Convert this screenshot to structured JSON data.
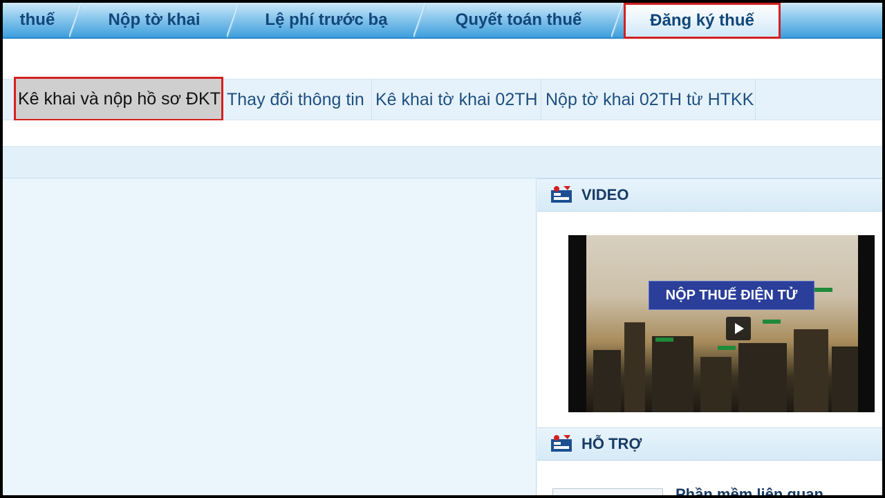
{
  "top_nav": {
    "tabs": [
      {
        "label": "thuế"
      },
      {
        "label": "Nộp tờ khai"
      },
      {
        "label": "Lệ phí trước bạ"
      },
      {
        "label": "Quyết toán thuế"
      },
      {
        "label": "Đăng ký thuế",
        "active": true
      }
    ]
  },
  "sub_nav": {
    "items": [
      {
        "label": "Kê khai và nộp hồ sơ ĐKT",
        "active": true
      },
      {
        "label": "Thay đổi thông tin"
      },
      {
        "label": "Kê khai tờ khai 02TH"
      },
      {
        "label": "Nộp tờ khai 02TH từ HTKK"
      }
    ]
  },
  "sidebar": {
    "video_title": "VIDEO",
    "video_banner": "NỘP THUẾ ĐIỆN TỬ",
    "support_title": "HỖ TRỢ",
    "support_item": "Phần mềm liên quan"
  },
  "colors": {
    "highlight_border": "#d42020",
    "nav_text": "#13467a",
    "active_sub_bg": "#cfcfcf"
  },
  "icons": [
    "section-header-icon",
    "play-icon"
  ]
}
